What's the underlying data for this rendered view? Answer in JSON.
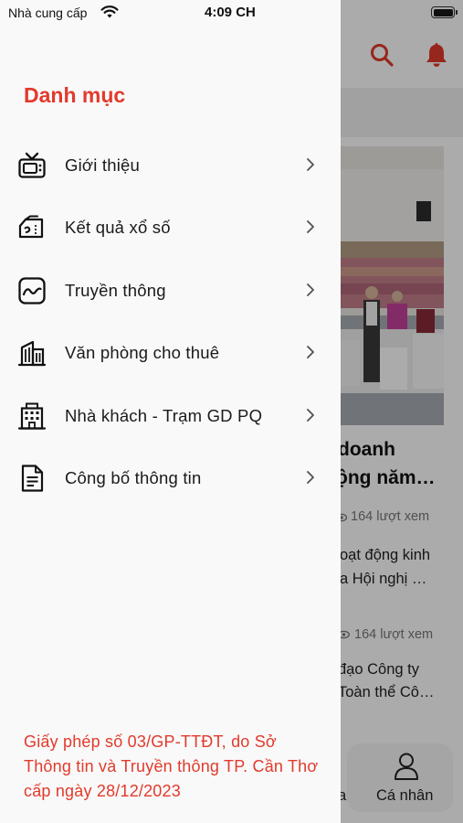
{
  "status_bar": {
    "carrier": "Nhà cung cấp",
    "time": "4:09 CH"
  },
  "drawer": {
    "title": "Danh mục",
    "items": [
      {
        "label": "Giới thiệu",
        "icon": "tv-icon"
      },
      {
        "label": "Kết quả xổ số",
        "icon": "lottery-ticket-icon"
      },
      {
        "label": "Truyền thông",
        "icon": "media-icon"
      },
      {
        "label": "Văn phòng cho thuê",
        "icon": "office-building-icon"
      },
      {
        "label": "Nhà khách - Trạm GD PQ",
        "icon": "guesthouse-building-icon"
      },
      {
        "label": "Công bố thông tin",
        "icon": "document-icon"
      }
    ],
    "license_text": "Giấy phép số 03/GP-TTĐT, do Sở Thông tin và Truyền thông TP. Cần Thơ cấp ngày 28/12/2023"
  },
  "background": {
    "article1_title_line1": "doanh",
    "article1_title_line2": "ộng năm…",
    "article1_views": "164 lượt xem",
    "article2_line1": "oạt động kinh",
    "article2_line2": "a Hội nghị …",
    "article2_views": "164 lượt xem",
    "article3_line1": "đạo Công ty",
    "article3_line2": "Toàn thể Cô…",
    "tab_partial_label": "ai",
    "tab_profile_label": "Cá nhân"
  },
  "colors": {
    "accent": "#e23a2c",
    "drawer_bg": "#f9f9f9",
    "overlay": "rgba(0,0,0,0.33)"
  }
}
